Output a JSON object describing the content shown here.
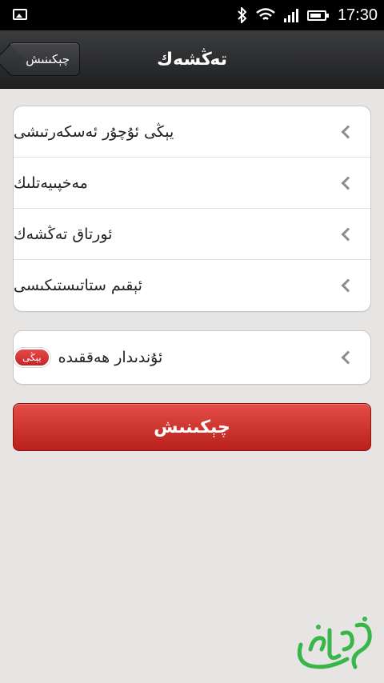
{
  "status_bar": {
    "time": "17:30"
  },
  "header": {
    "back_label": "چېكىنىش",
    "title": "تەڭشەك"
  },
  "settings_list": [
    {
      "label": "يېڭى ئۇچۇر ئەسكەرتىشى"
    },
    {
      "label": "مەخپىيەتلىك"
    },
    {
      "label": "ئورتاق تەڭشەك"
    },
    {
      "label": "ئېقىم ستاتىستىكىسى"
    }
  ],
  "about": {
    "label": "ئۇندىدار ھەققىدە",
    "badge": "يېڭى"
  },
  "exit_button": {
    "label": "چېكىنىش"
  },
  "colors": {
    "accent_red": "#d0322e",
    "titlebar": "#2a2b2d",
    "logo_green": "#39b54a"
  }
}
